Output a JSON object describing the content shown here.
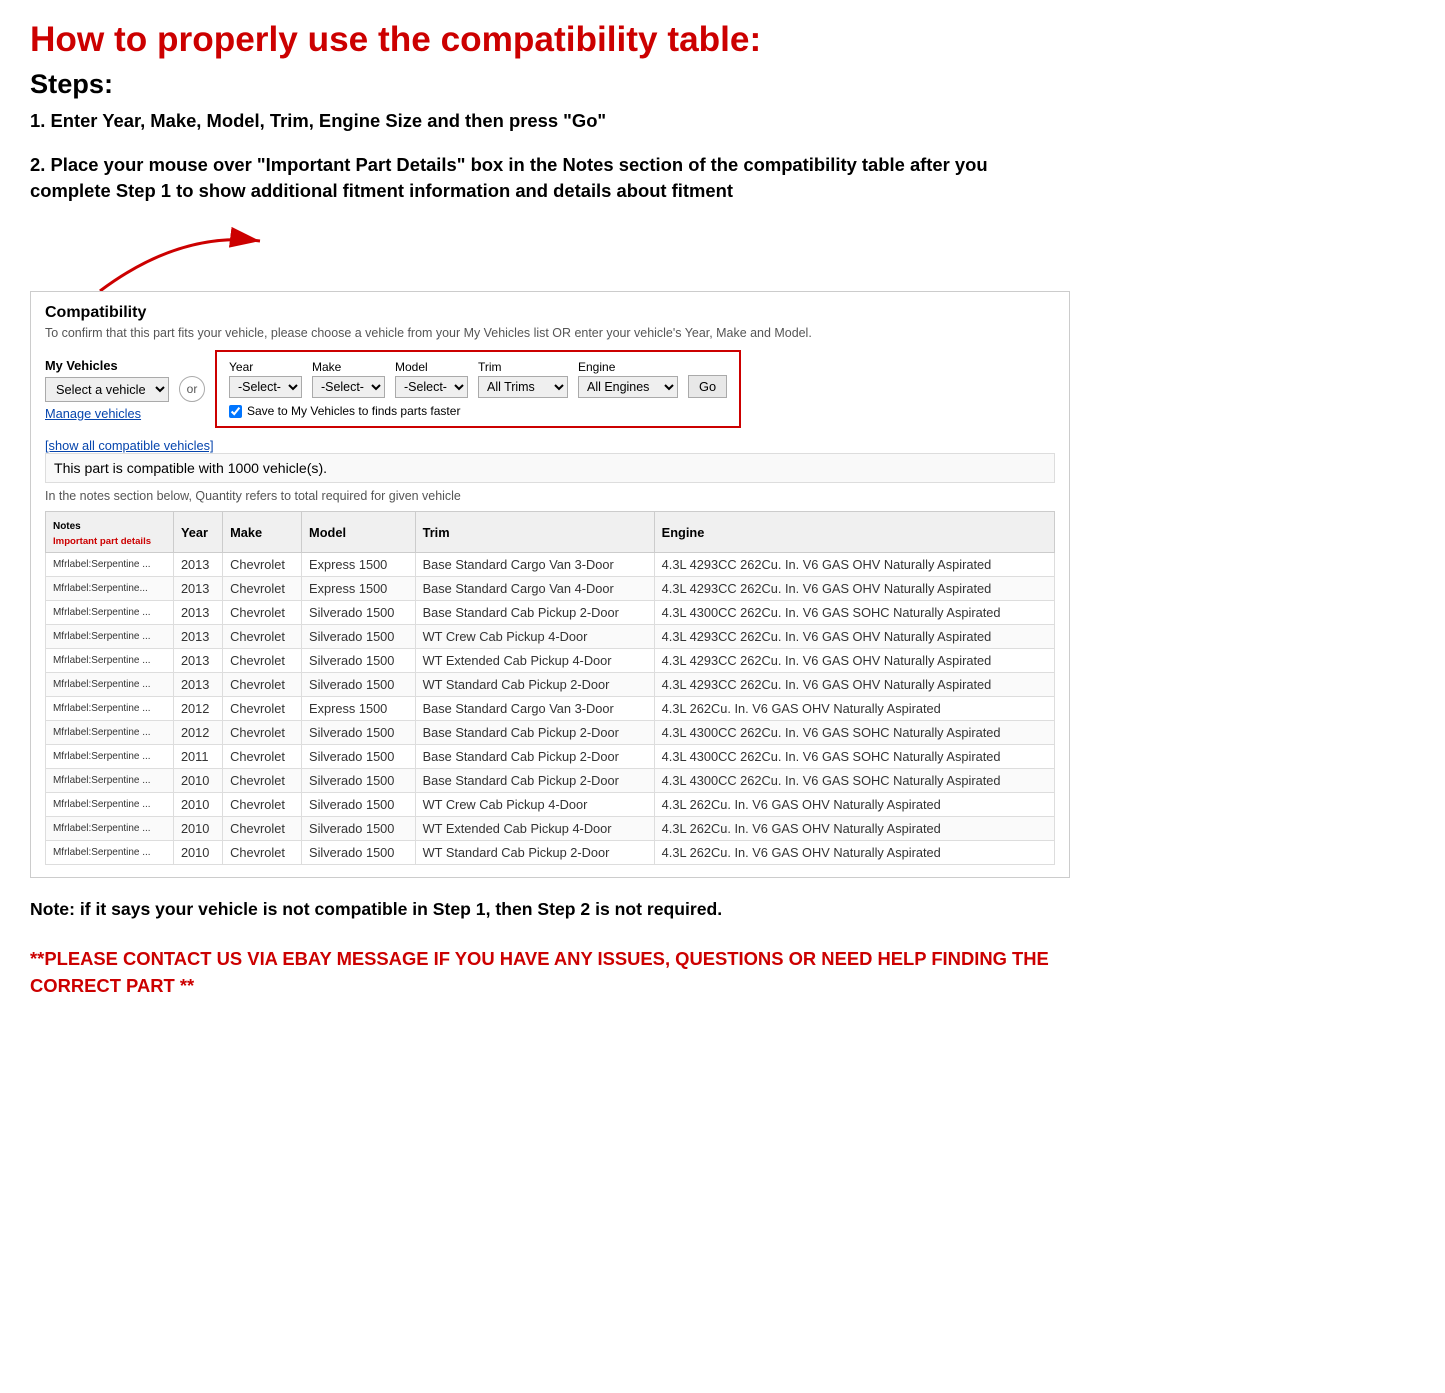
{
  "title": "How to properly use the compatibility table:",
  "steps_label": "Steps:",
  "step1": "1. Enter Year, Make, Model, Trim, Engine Size and then press \"Go\"",
  "step2": "2. Place your mouse over \"Important Part Details\" box in the Notes section of the compatibility table after you complete Step 1 to show additional fitment information and details about fitment",
  "compatibility": {
    "title": "Compatibility",
    "subtitle": "To confirm that this part fits your vehicle, please choose a vehicle from your My Vehicles list OR enter your vehicle's Year, Make and Model.",
    "my_vehicles_label": "My Vehicles",
    "select_vehicle_placeholder": "Select a vehicle",
    "or_label": "or",
    "manage_vehicles": "Manage vehicles",
    "show_all": "[show all compatible vehicles]",
    "year_label": "Year",
    "make_label": "Make",
    "model_label": "Model",
    "trim_label": "Trim",
    "engine_label": "Engine",
    "year_default": "-Select-",
    "make_default": "-Select-",
    "model_default": "-Select-",
    "trim_default": "All Trims",
    "engine_default": "All Engines",
    "go_button": "Go",
    "save_label": "Save to My Vehicles to finds parts faster",
    "compatible_count": "This part is compatible with 1000 vehicle(s).",
    "quantity_note": "In the notes section below, Quantity refers to total required for given vehicle",
    "table_headers": [
      "Notes",
      "Year",
      "Make",
      "Model",
      "Trim",
      "Engine"
    ],
    "important_part_label": "Important part details",
    "rows": [
      {
        "notes": "Mfrlabel:Serpentine ...",
        "year": "2013",
        "make": "Chevrolet",
        "model": "Express 1500",
        "trim": "Base Standard Cargo Van 3-Door",
        "engine": "4.3L 4293CC 262Cu. In. V6 GAS OHV Naturally Aspirated"
      },
      {
        "notes": "Mfrlabel:Serpentine...",
        "year": "2013",
        "make": "Chevrolet",
        "model": "Express 1500",
        "trim": "Base Standard Cargo Van 4-Door",
        "engine": "4.3L 4293CC 262Cu. In. V6 GAS OHV Naturally Aspirated"
      },
      {
        "notes": "Mfrlabel:Serpentine ...",
        "year": "2013",
        "make": "Chevrolet",
        "model": "Silverado 1500",
        "trim": "Base Standard Cab Pickup 2-Door",
        "engine": "4.3L 4300CC 262Cu. In. V6 GAS SOHC Naturally Aspirated"
      },
      {
        "notes": "Mfrlabel:Serpentine ...",
        "year": "2013",
        "make": "Chevrolet",
        "model": "Silverado 1500",
        "trim": "WT Crew Cab Pickup 4-Door",
        "engine": "4.3L 4293CC 262Cu. In. V6 GAS OHV Naturally Aspirated"
      },
      {
        "notes": "Mfrlabel:Serpentine ...",
        "year": "2013",
        "make": "Chevrolet",
        "model": "Silverado 1500",
        "trim": "WT Extended Cab Pickup 4-Door",
        "engine": "4.3L 4293CC 262Cu. In. V6 GAS OHV Naturally Aspirated"
      },
      {
        "notes": "Mfrlabel:Serpentine ...",
        "year": "2013",
        "make": "Chevrolet",
        "model": "Silverado 1500",
        "trim": "WT Standard Cab Pickup 2-Door",
        "engine": "4.3L 4293CC 262Cu. In. V6 GAS OHV Naturally Aspirated"
      },
      {
        "notes": "Mfrlabel:Serpentine ...",
        "year": "2012",
        "make": "Chevrolet",
        "model": "Express 1500",
        "trim": "Base Standard Cargo Van 3-Door",
        "engine": "4.3L 262Cu. In. V6 GAS OHV Naturally Aspirated"
      },
      {
        "notes": "Mfrlabel:Serpentine ...",
        "year": "2012",
        "make": "Chevrolet",
        "model": "Silverado 1500",
        "trim": "Base Standard Cab Pickup 2-Door",
        "engine": "4.3L 4300CC 262Cu. In. V6 GAS SOHC Naturally Aspirated"
      },
      {
        "notes": "Mfrlabel:Serpentine ...",
        "year": "2011",
        "make": "Chevrolet",
        "model": "Silverado 1500",
        "trim": "Base Standard Cab Pickup 2-Door",
        "engine": "4.3L 4300CC 262Cu. In. V6 GAS SOHC Naturally Aspirated"
      },
      {
        "notes": "Mfrlabel:Serpentine ...",
        "year": "2010",
        "make": "Chevrolet",
        "model": "Silverado 1500",
        "trim": "Base Standard Cab Pickup 2-Door",
        "engine": "4.3L 4300CC 262Cu. In. V6 GAS SOHC Naturally Aspirated"
      },
      {
        "notes": "Mfrlabel:Serpentine ...",
        "year": "2010",
        "make": "Chevrolet",
        "model": "Silverado 1500",
        "trim": "WT Crew Cab Pickup 4-Door",
        "engine": "4.3L 262Cu. In. V6 GAS OHV Naturally Aspirated"
      },
      {
        "notes": "Mfrlabel:Serpentine ...",
        "year": "2010",
        "make": "Chevrolet",
        "model": "Silverado 1500",
        "trim": "WT Extended Cab Pickup 4-Door",
        "engine": "4.3L 262Cu. In. V6 GAS OHV Naturally Aspirated"
      },
      {
        "notes": "Mfrlabel:Serpentine ...",
        "year": "2010",
        "make": "Chevrolet",
        "model": "Silverado 1500",
        "trim": "WT Standard Cab Pickup 2-Door",
        "engine": "4.3L 262Cu. In. V6 GAS OHV Naturally Aspirated"
      }
    ]
  },
  "note_text": "Note: if it says your vehicle is not compatible in Step 1, then Step 2 is not required.",
  "contact_text": "**PLEASE CONTACT US VIA EBAY MESSAGE IF YOU HAVE ANY ISSUES, QUESTIONS OR NEED HELP FINDING THE CORRECT PART **"
}
